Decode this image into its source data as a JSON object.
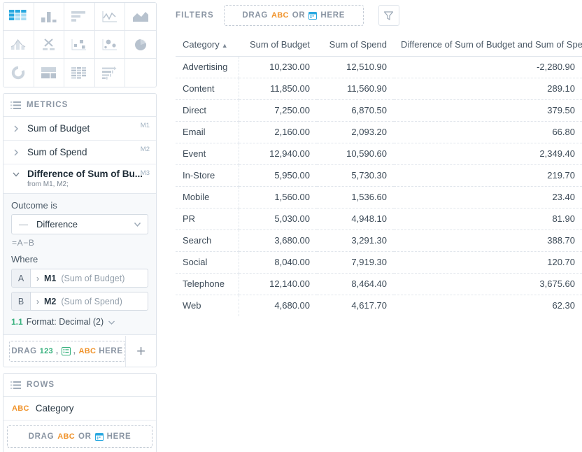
{
  "chart_types": [
    {
      "name": "table-chart-type",
      "icon": "grid-icon",
      "selected": true
    },
    {
      "name": "column-chart-type",
      "icon": "bar-column-icon",
      "selected": false
    },
    {
      "name": "bar-chart-type",
      "icon": "horizontal-bar-icon",
      "selected": false
    },
    {
      "name": "line-chart-type",
      "icon": "line-chart-icon",
      "selected": false
    },
    {
      "name": "area-chart-type",
      "icon": "area-chart-icon",
      "selected": false
    },
    {
      "name": "combo-chart-type",
      "icon": "combo-chart-icon",
      "selected": false
    },
    {
      "name": "xy-chart-type",
      "icon": "x-scatter-icon",
      "selected": false
    },
    {
      "name": "bubble-chart-type",
      "icon": "square-scatter-icon",
      "selected": false
    },
    {
      "name": "scatter-chart-type",
      "icon": "dot-scatter-icon",
      "selected": false
    },
    {
      "name": "pie-chart-type",
      "icon": "pie-chart-icon",
      "selected": false
    },
    {
      "name": "donut-chart-type",
      "icon": "donut-chart-icon",
      "selected": false
    },
    {
      "name": "layout-chart-type",
      "icon": "layout-blocks-icon",
      "selected": false
    },
    {
      "name": "grid-chart-type",
      "icon": "data-grid-icon",
      "selected": false
    },
    {
      "name": "gantt-chart-type",
      "icon": "gantt-bars-icon",
      "selected": false
    },
    {
      "name": "empty-chart-type",
      "icon": "blank-icon",
      "selected": false
    }
  ],
  "metrics_panel": {
    "header": "METRICS",
    "items": [
      {
        "label": "Sum of Budget",
        "tag": "M1",
        "expanded": false
      },
      {
        "label": "Sum of Spend",
        "tag": "M2",
        "expanded": false
      }
    ],
    "expanded_metric": {
      "label": "Difference of Sum of Bu...",
      "tag": "M3",
      "subtitle": "from M1, M2;",
      "outcome_label": "Outcome is",
      "outcome_glyph": "—",
      "outcome_value": "Difference",
      "formula": "=A−B",
      "where_label": "Where",
      "operands": [
        {
          "letter": "A",
          "code": "M1",
          "desc": "(Sum of Budget)"
        },
        {
          "letter": "B",
          "code": "M2",
          "desc": "(Sum of Spend)"
        }
      ],
      "format_prefix": "1.1",
      "format_label": "Format: Decimal (2)"
    },
    "dropzone": {
      "drag": "DRAG",
      "badge_123": "123",
      "sep1": ",",
      "sep2": ",",
      "badge_abc": "ABC",
      "here": "HERE"
    },
    "add_button": "+"
  },
  "rows_panel": {
    "header": "ROWS",
    "items": [
      {
        "badge": "ABC",
        "label": "Category"
      }
    ],
    "dropzone": {
      "drag": "DRAG",
      "badge_abc": "ABC",
      "or": "OR",
      "here": "HERE"
    }
  },
  "filters_bar": {
    "label": "FILTERS",
    "dropzone": {
      "drag": "DRAG",
      "badge_abc": "ABC",
      "or": "OR",
      "here": "HERE"
    },
    "funnel_icon": "filter-funnel-icon"
  },
  "chart_data": {
    "type": "table",
    "title": "",
    "sort_column": "Category",
    "sort_direction": "asc",
    "sort_caret": "▲",
    "columns": [
      {
        "header": "Category",
        "align": "left"
      },
      {
        "header": "Sum of Budget",
        "align": "right"
      },
      {
        "header": "Sum of Spend",
        "align": "right"
      },
      {
        "header": "Difference of Sum of Budget and Sum of Spend",
        "align": "right"
      }
    ],
    "categories": [
      "Advertising",
      "Content",
      "Direct",
      "Email",
      "Event",
      "In-Store",
      "Mobile",
      "PR",
      "Search",
      "Social",
      "Telephone",
      "Web"
    ],
    "series": [
      {
        "name": "Sum of Budget",
        "values": [
          10230.0,
          11850.0,
          7250.0,
          2160.0,
          12940.0,
          5950.0,
          1560.0,
          5030.0,
          3680.0,
          8040.0,
          12140.0,
          4680.0
        ]
      },
      {
        "name": "Sum of Spend",
        "values": [
          12510.9,
          11560.9,
          6870.5,
          2093.2,
          10590.6,
          5730.3,
          1536.6,
          4948.1,
          3291.3,
          7919.3,
          8464.4,
          4617.7
        ]
      },
      {
        "name": "Difference of Sum of Budget and Sum of Spend",
        "values": [
          -2280.9,
          289.1,
          379.5,
          66.8,
          2349.4,
          219.7,
          23.4,
          81.9,
          388.7,
          120.7,
          3675.6,
          62.3
        ]
      }
    ],
    "rows": [
      {
        "cells": [
          "Advertising",
          "10,230.00",
          "12,510.90",
          "-2,280.90"
        ]
      },
      {
        "cells": [
          "Content",
          "11,850.00",
          "11,560.90",
          "289.10"
        ]
      },
      {
        "cells": [
          "Direct",
          "7,250.00",
          "6,870.50",
          "379.50"
        ]
      },
      {
        "cells": [
          "Email",
          "2,160.00",
          "2,093.20",
          "66.80"
        ]
      },
      {
        "cells": [
          "Event",
          "12,940.00",
          "10,590.60",
          "2,349.40"
        ]
      },
      {
        "cells": [
          "In-Store",
          "5,950.00",
          "5,730.30",
          "219.70"
        ]
      },
      {
        "cells": [
          "Mobile",
          "1,560.00",
          "1,536.60",
          "23.40"
        ]
      },
      {
        "cells": [
          "PR",
          "5,030.00",
          "4,948.10",
          "81.90"
        ]
      },
      {
        "cells": [
          "Search",
          "3,680.00",
          "3,291.30",
          "388.70"
        ]
      },
      {
        "cells": [
          "Social",
          "8,040.00",
          "7,919.30",
          "120.70"
        ]
      },
      {
        "cells": [
          "Telephone",
          "12,140.00",
          "8,464.40",
          "3,675.60"
        ]
      },
      {
        "cells": [
          "Web",
          "4,680.00",
          "4,617.70",
          "62.30"
        ]
      }
    ]
  },
  "colors": {
    "accent_blue": "#29a8e0",
    "icon_gray": "#b7c2ce",
    "border": "#dde3ea",
    "text": "#3d4b58",
    "muted": "#8a95a3",
    "badge_abc": "#f0932b",
    "badge_123": "#35b07c",
    "badge_date": "#29a8e0"
  }
}
